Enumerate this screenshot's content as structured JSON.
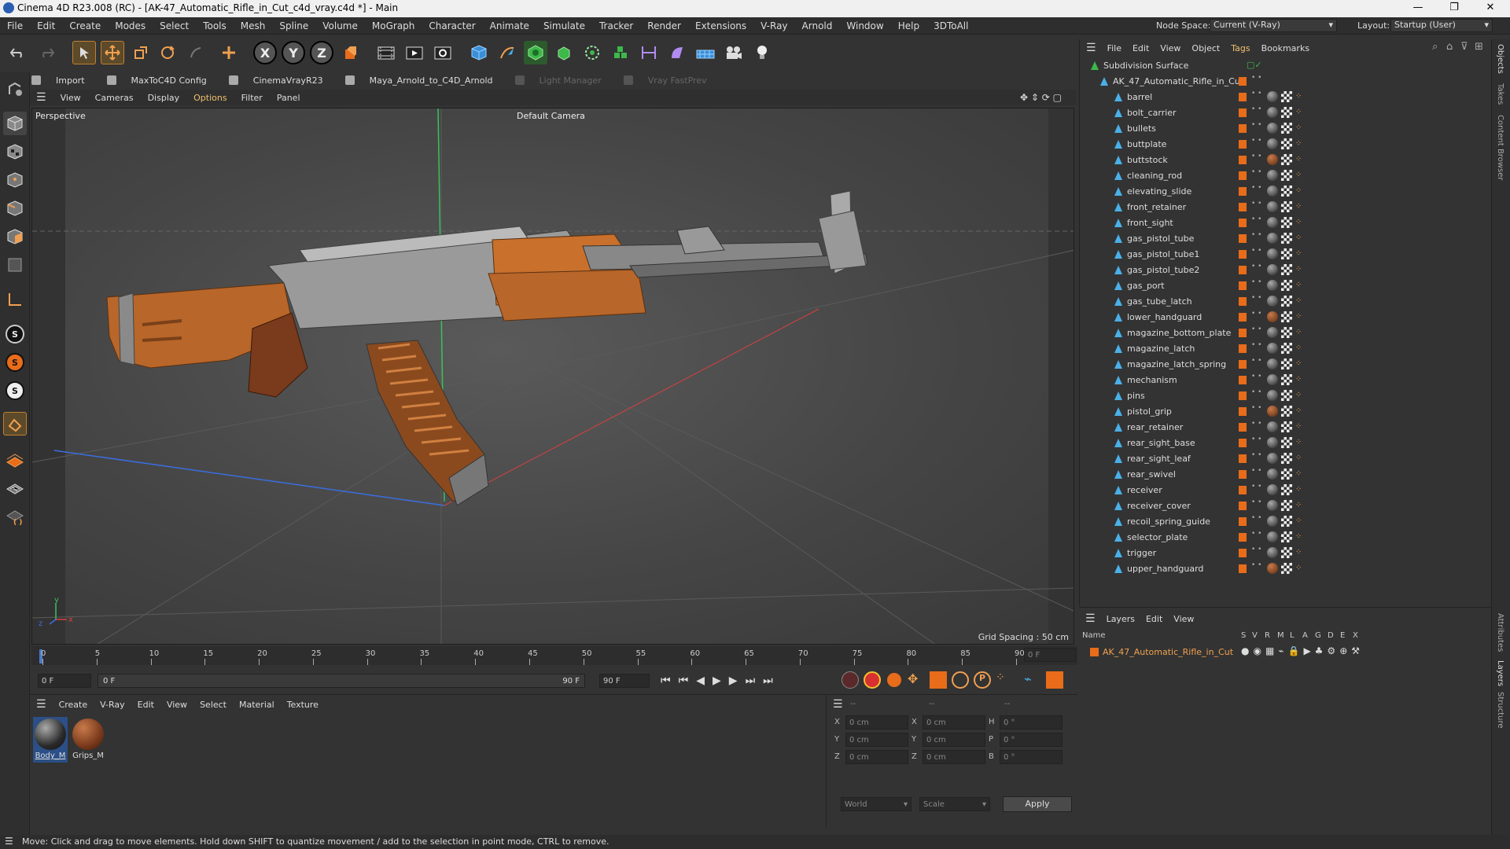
{
  "window": {
    "title": "Cinema 4D R23.008 (RC) - [AK-47_Automatic_Rifle_in_Cut_c4d_vray.c4d *] - Main",
    "minimize": "—",
    "maximize": "❐",
    "close": "✕"
  },
  "menu": {
    "items": [
      "File",
      "Edit",
      "Create",
      "Modes",
      "Select",
      "Tools",
      "Mesh",
      "Spline",
      "Volume",
      "MoGraph",
      "Character",
      "Animate",
      "Simulate",
      "Tracker",
      "Render",
      "Extensions",
      "V-Ray",
      "Arnold",
      "Window",
      "Help",
      "3DToAll"
    ],
    "node_space_label": "Node Space:",
    "node_space_value": "Current (V-Ray)",
    "layout_label": "Layout:",
    "layout_value": "Startup (User)"
  },
  "plugins": {
    "items": [
      "Import",
      "MaxToC4D Config",
      "CinemaVrayR23",
      "Maya_Arnold_to_C4D_Arnold",
      "Light Manager",
      "Vray FastPrev"
    ]
  },
  "viewport": {
    "menu": [
      "View",
      "Cameras",
      "Display",
      "Options",
      "Filter",
      "Panel"
    ],
    "label": "Perspective",
    "camera": "Default Camera",
    "grid_spacing": "Grid Spacing : 50 cm",
    "axis_y": "y",
    "axis_x": "x",
    "axis_z": "z"
  },
  "timeline": {
    "ticks": [
      "0",
      "5",
      "10",
      "15",
      "20",
      "25",
      "30",
      "35",
      "40",
      "45",
      "50",
      "55",
      "60",
      "65",
      "70",
      "75",
      "80",
      "85",
      "90"
    ],
    "current_frame": "0 F",
    "start": "0 F",
    "slider_start": "0 F",
    "slider_end": "90 F",
    "end": "90 F"
  },
  "materials": {
    "menu": [
      "Create",
      "V-Ray",
      "Edit",
      "View",
      "Select",
      "Material",
      "Texture"
    ],
    "items": [
      {
        "label": "Body_M",
        "color": "#2a2a2a"
      },
      {
        "label": "Grips_M",
        "color": "#7a3a1c"
      }
    ]
  },
  "coordinates": {
    "header": [
      "--",
      "--",
      "--"
    ],
    "rows": [
      {
        "a": "X",
        "av": "0 cm",
        "b": "X",
        "bv": "0 cm",
        "c": "H",
        "cv": "0 °"
      },
      {
        "a": "Y",
        "av": "0 cm",
        "b": "Y",
        "bv": "0 cm",
        "c": "P",
        "cv": "0 °"
      },
      {
        "a": "Z",
        "av": "0 cm",
        "b": "Z",
        "bv": "0 cm",
        "c": "B",
        "cv": "0 °"
      }
    ],
    "world": "World",
    "scale": "Scale",
    "apply": "Apply"
  },
  "objects": {
    "menu": [
      "File",
      "Edit",
      "View",
      "Object",
      "Tags",
      "Bookmarks"
    ],
    "root": "Subdivision Surface",
    "group": "AK_47_Automatic_Rifle_in_Cut",
    "children": [
      "barrel",
      "bolt_carrier",
      "bullets",
      "buttplate",
      "buttstock",
      "cleaning_rod",
      "elevating_slide",
      "front_retainer",
      "front_sight",
      "gas_pistol_tube",
      "gas_pistol_tube1",
      "gas_pistol_tube2",
      "gas_port",
      "gas_tube_latch",
      "lower_handguard",
      "magazine_bottom_plate",
      "magazine_latch",
      "magazine_latch_spring",
      "mechanism",
      "pins",
      "pistol_grip",
      "rear_retainer",
      "rear_sight_base",
      "rear_sight_leaf",
      "rear_swivel",
      "receiver",
      "receiver_cover",
      "recoil_spring_guide",
      "selector_plate",
      "trigger",
      "upper_handguard"
    ]
  },
  "layers": {
    "menu": [
      "Layers",
      "Edit",
      "View"
    ],
    "columns": [
      "Name",
      "S",
      "V",
      "R",
      "M",
      "L",
      "A",
      "G",
      "D",
      "E",
      "X"
    ],
    "row": "AK_47_Automatic_Rifle_in_Cut"
  },
  "right_tabs": [
    "Objects",
    "Takes",
    "Content Browser",
    "Attributes",
    "Layers",
    "Structure"
  ],
  "status": "Move: Click and drag to move elements. Hold down SHIFT to quantize movement / add to the selection in point mode, CTRL to remove.",
  "colors": {
    "accent": "#f0a050",
    "orange": "#e86c1a",
    "wood": "#b8662a"
  }
}
